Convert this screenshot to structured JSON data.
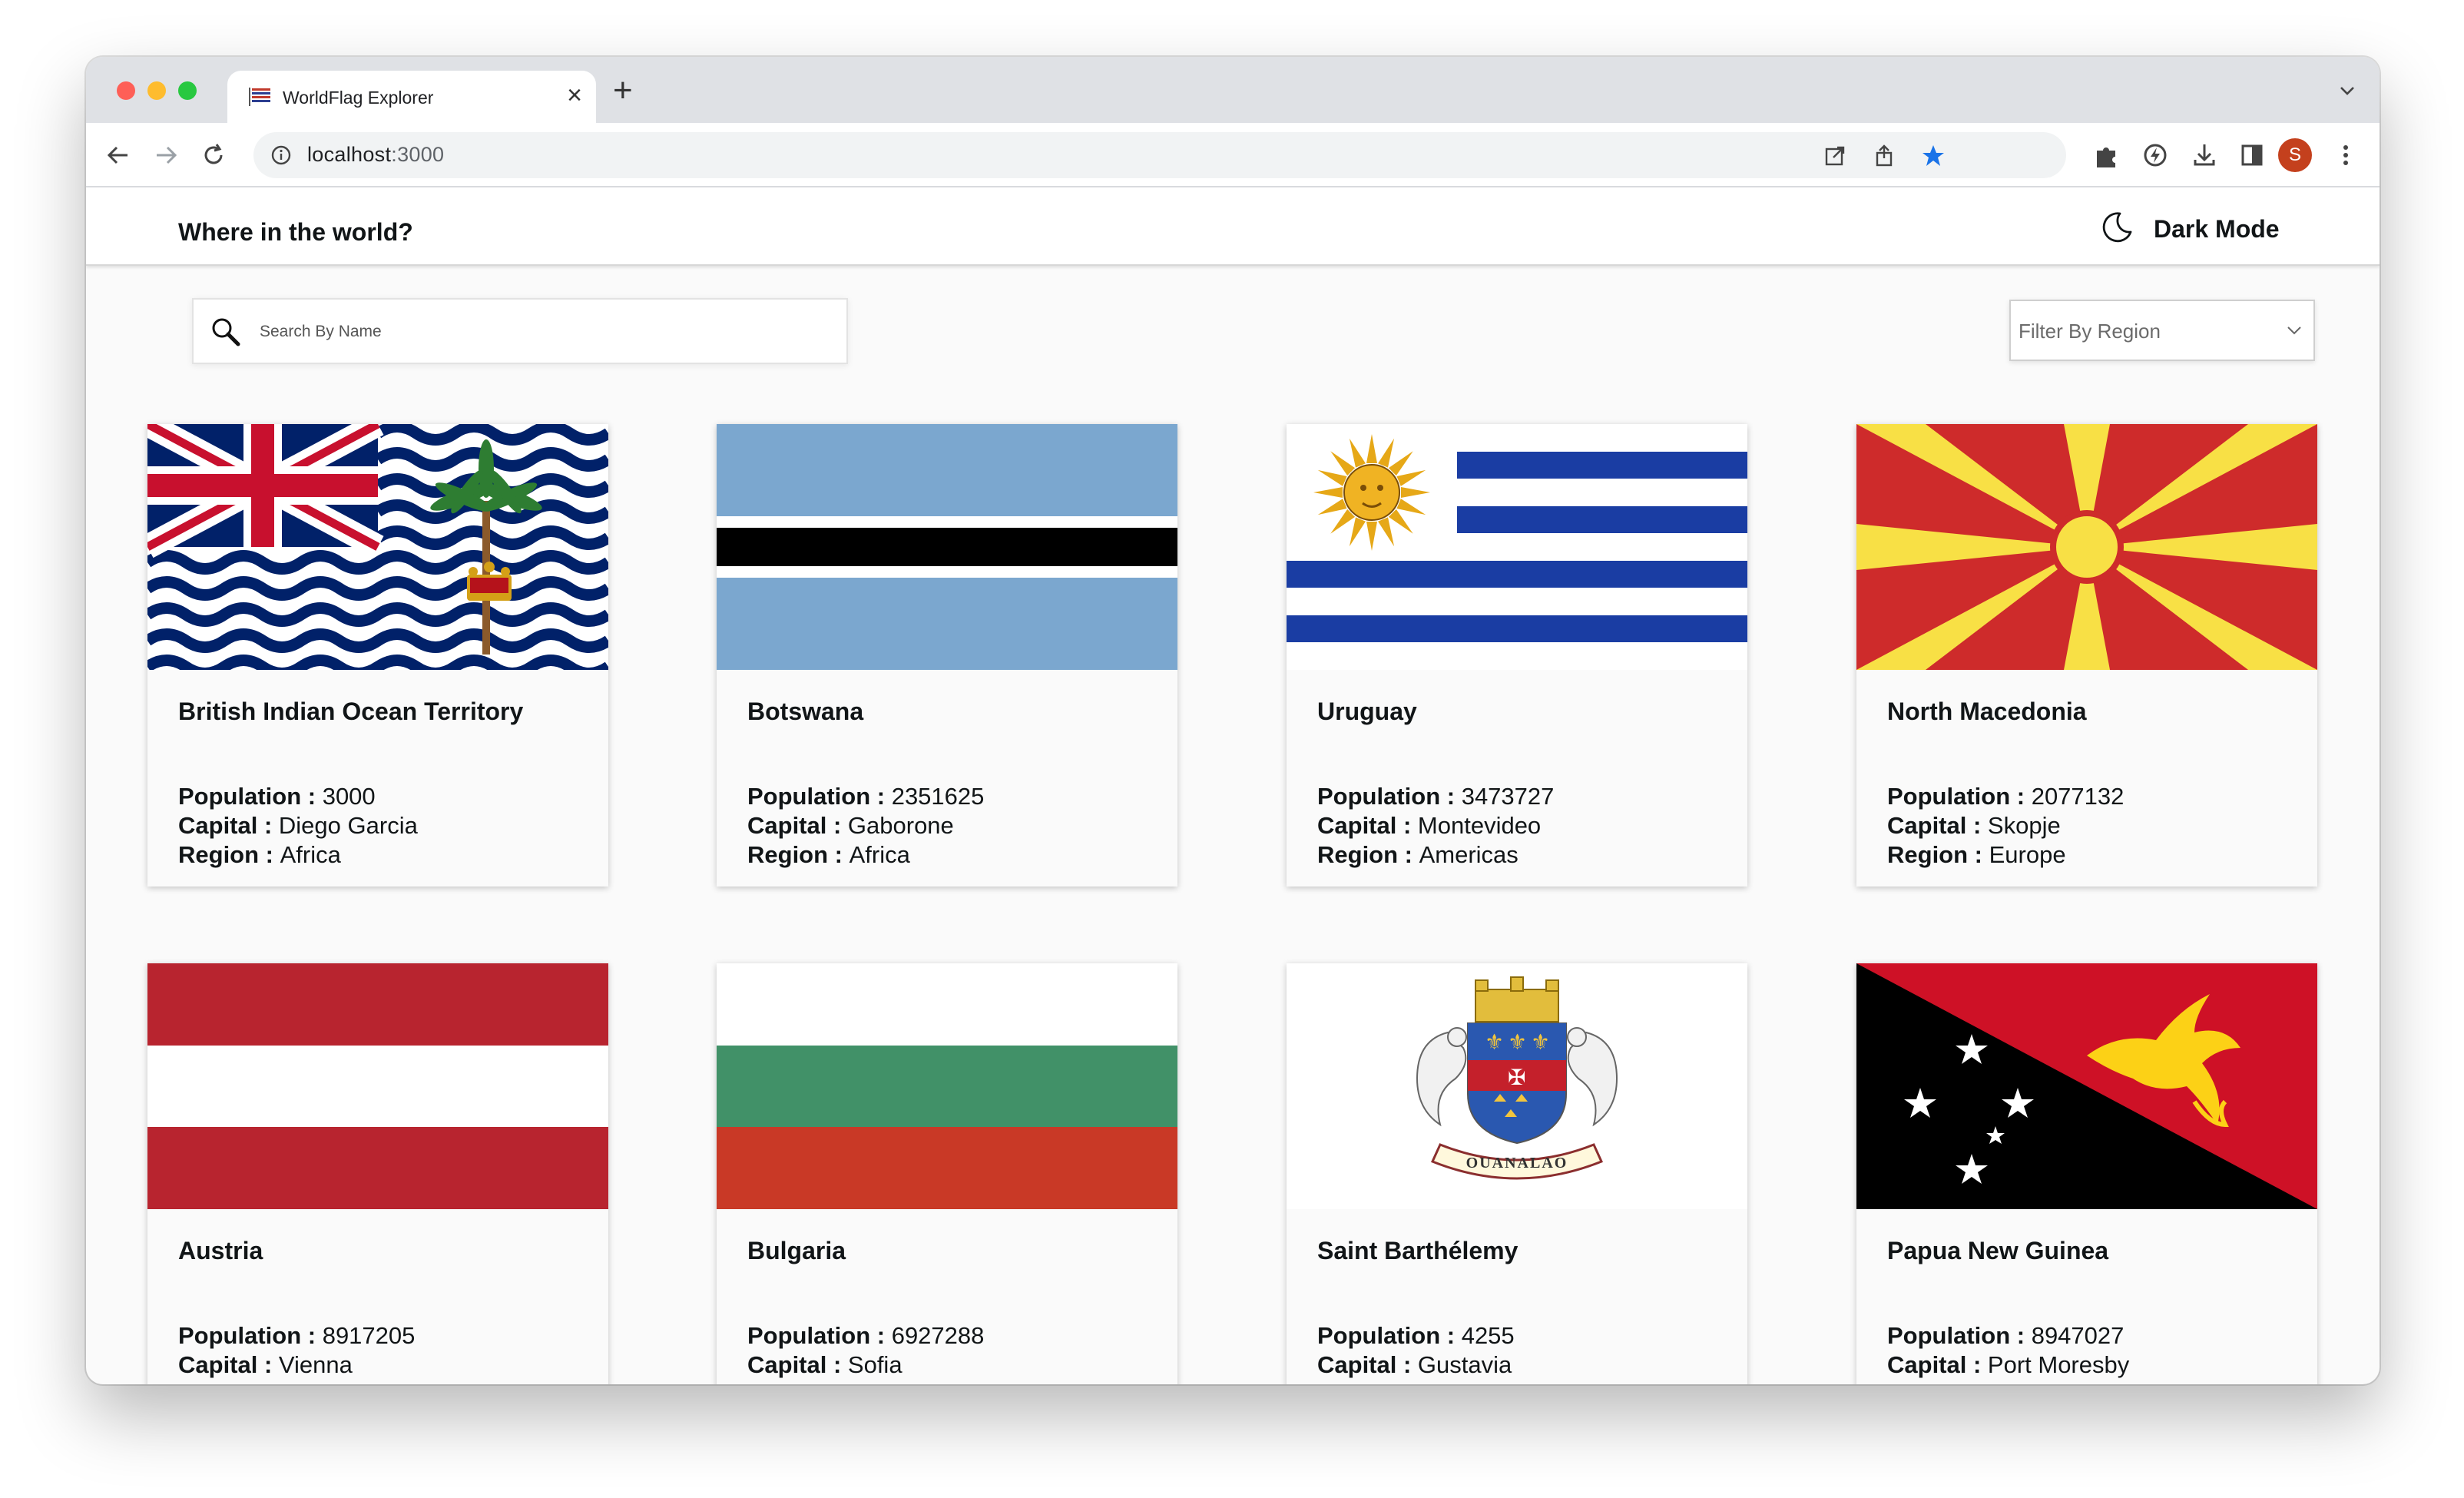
{
  "browser": {
    "tab_title": "WorldFlag Explorer",
    "url_host": "localhost",
    "url_port": ":3000",
    "profile_initial": "S",
    "star_color": "#1a73e8",
    "profile_color": "#c4401d"
  },
  "app": {
    "title": "Where in the world?",
    "dark_mode_label": "Dark Mode",
    "search_placeholder": "Search By Name",
    "filter_label": "Filter By Region"
  },
  "labels": {
    "population": "Population : ",
    "capital": "Capital : ",
    "region": "Region : "
  },
  "countries": [
    {
      "name": "British Indian Ocean Territory",
      "population": "3000",
      "capital": "Diego Garcia",
      "region": "Africa",
      "flag": "flag-british-indian-ocean-territory-icon"
    },
    {
      "name": "Botswana",
      "population": "2351625",
      "capital": "Gaborone",
      "region": "Africa",
      "flag": "flag-botswana-icon"
    },
    {
      "name": "Uruguay",
      "population": "3473727",
      "capital": "Montevideo",
      "region": "Americas",
      "flag": "flag-uruguay-icon"
    },
    {
      "name": "North Macedonia",
      "population": "2077132",
      "capital": "Skopje",
      "region": "Europe",
      "flag": "flag-north-macedonia-icon"
    },
    {
      "name": "Austria",
      "population": "8917205",
      "capital": "Vienna",
      "flag": "flag-austria-icon"
    },
    {
      "name": "Bulgaria",
      "population": "6927288",
      "capital": "Sofia",
      "flag": "flag-bulgaria-icon"
    },
    {
      "name": "Saint Barthélemy",
      "population": "4255",
      "capital": "Gustavia",
      "flag": "flag-saint-barthelemy-icon",
      "motto": "OUANALAO"
    },
    {
      "name": "Papua New Guinea",
      "population": "8947027",
      "capital": "Port Moresby",
      "flag": "flag-papua-new-guinea-icon"
    }
  ]
}
